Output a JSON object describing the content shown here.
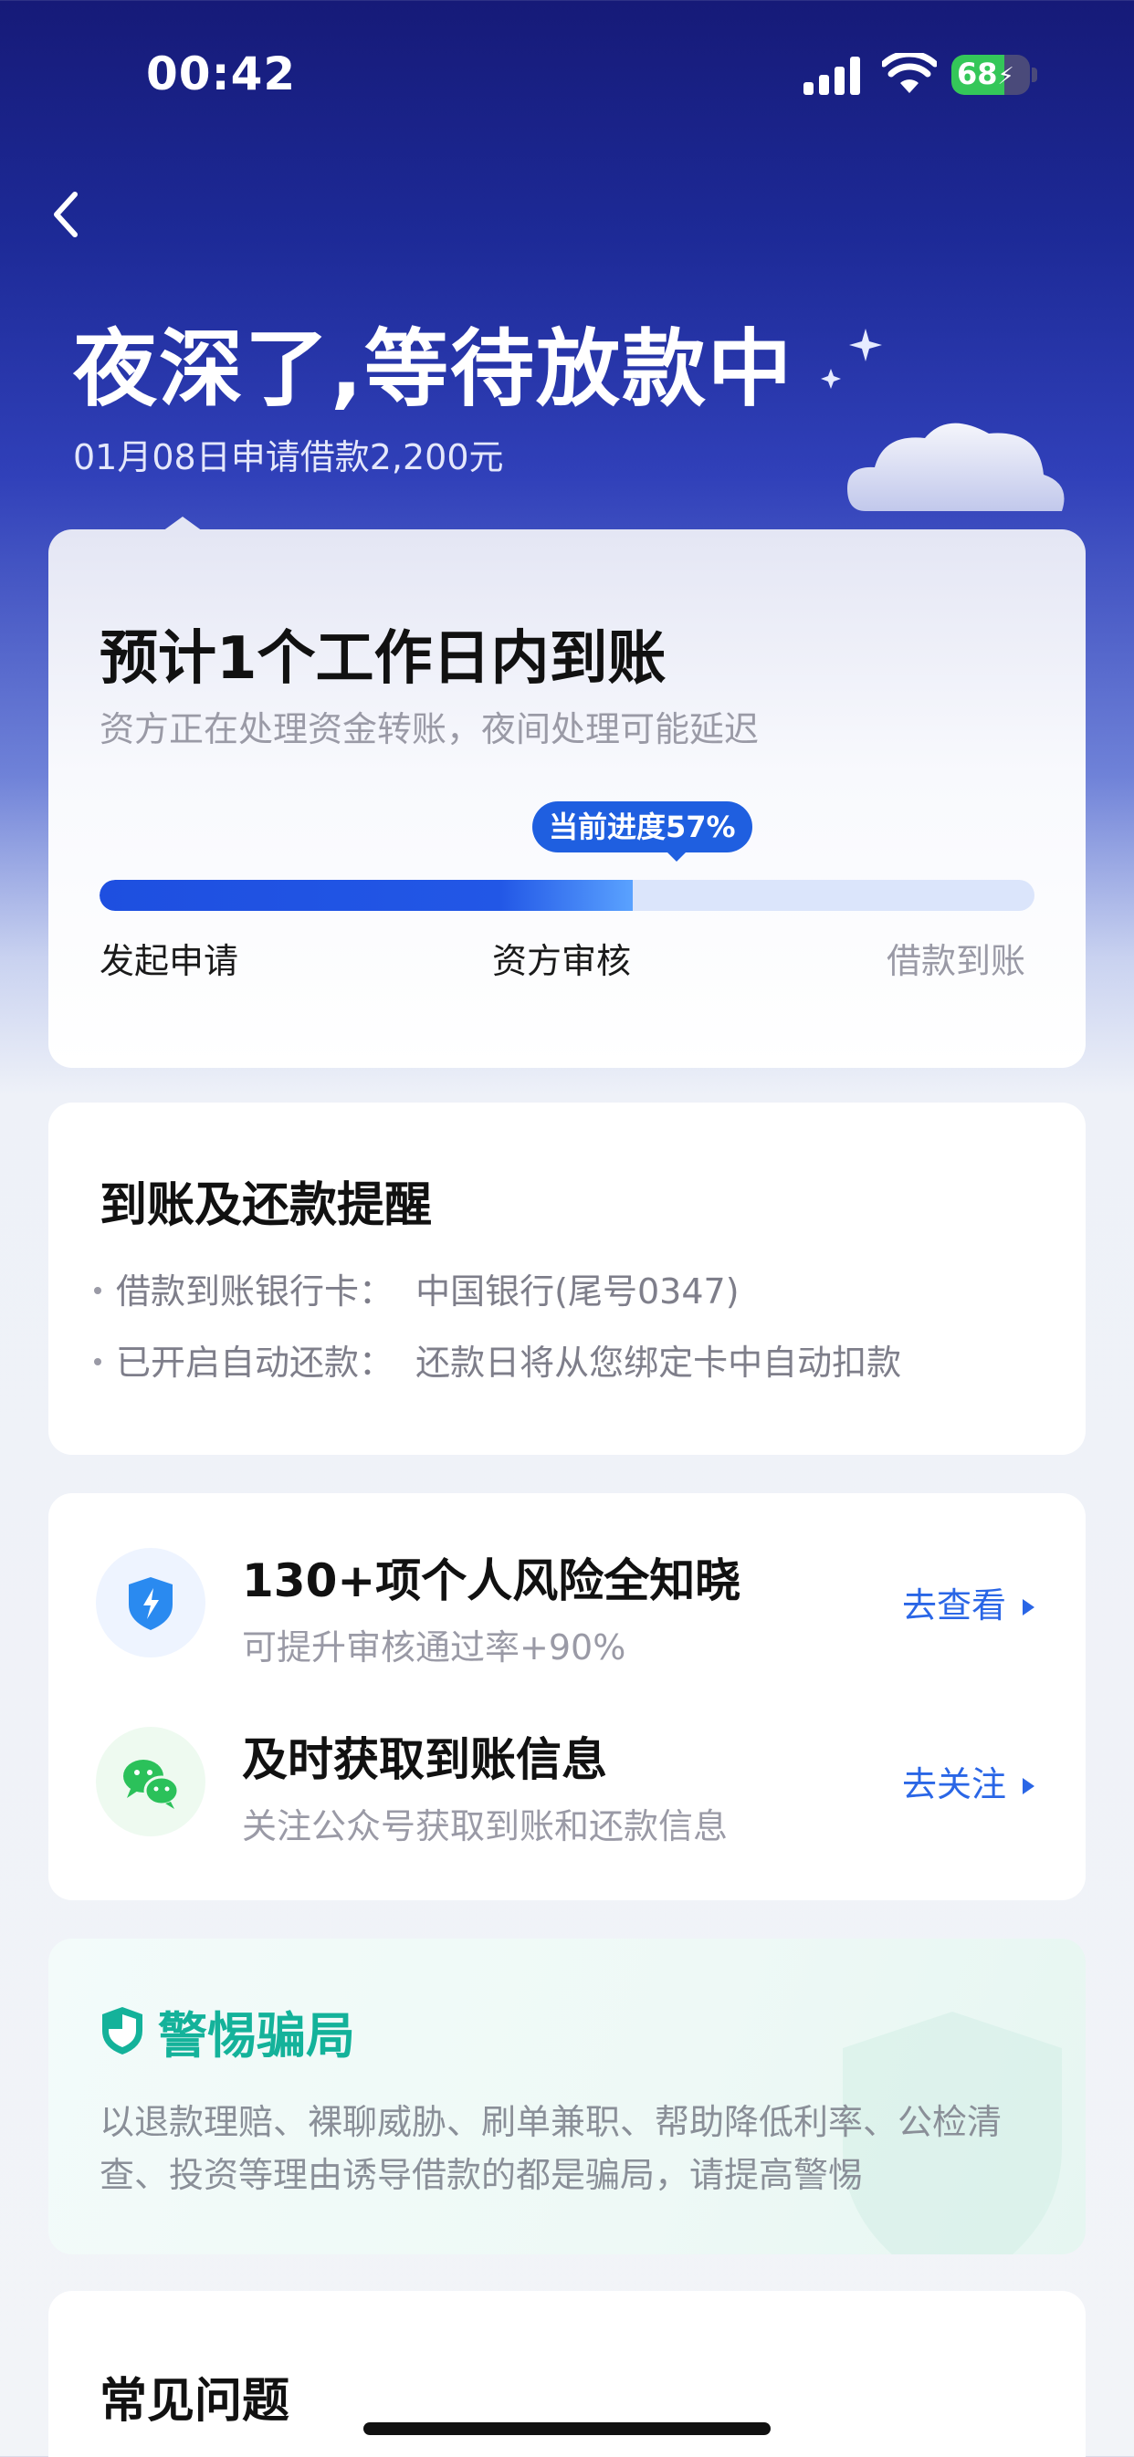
{
  "status_bar": {
    "time": "00:42",
    "battery_level": "68",
    "battery_fraction": 0.68
  },
  "header": {
    "title": "夜深了,等待放款中",
    "subtitle": "01月08日申请借款2,200元"
  },
  "progress_card": {
    "title": "预计1个工作日内到账",
    "description": "资方正在处理资金转账，夜间处理可能延迟",
    "badge": "当前进度57%",
    "progress": 0.57,
    "steps": [
      "发起申请",
      "资方审核",
      "借款到账"
    ]
  },
  "reminder_card": {
    "title": "到账及还款提醒",
    "items": [
      "借款到账银行卡：  中国银行(尾号0347)",
      "已开启自动还款：  还款日将从您绑定卡中自动扣款"
    ]
  },
  "services": [
    {
      "icon": "shield-lightning-icon",
      "title": "130+项个人风险全知晓",
      "subtitle": "可提升审核通过率+90%",
      "link": "去查看"
    },
    {
      "icon": "wechat-icon",
      "title": "及时获取到账信息",
      "subtitle": "关注公众号获取到账和还款信息",
      "link": "去关注"
    }
  ],
  "fraud_card": {
    "title": "警惕骗局",
    "text": "以退款理赔、裸聊威胁、刷单兼职、帮助降低利率、公检清查、投资等理由诱导借款的都是骗局，请提高警惕"
  },
  "faq": {
    "title": "常见问题"
  },
  "colors": {
    "accent": "#1f5fe0",
    "link": "#2a66e6",
    "fraud_green": "#14b29a",
    "header_bg": "#1d2a97"
  }
}
